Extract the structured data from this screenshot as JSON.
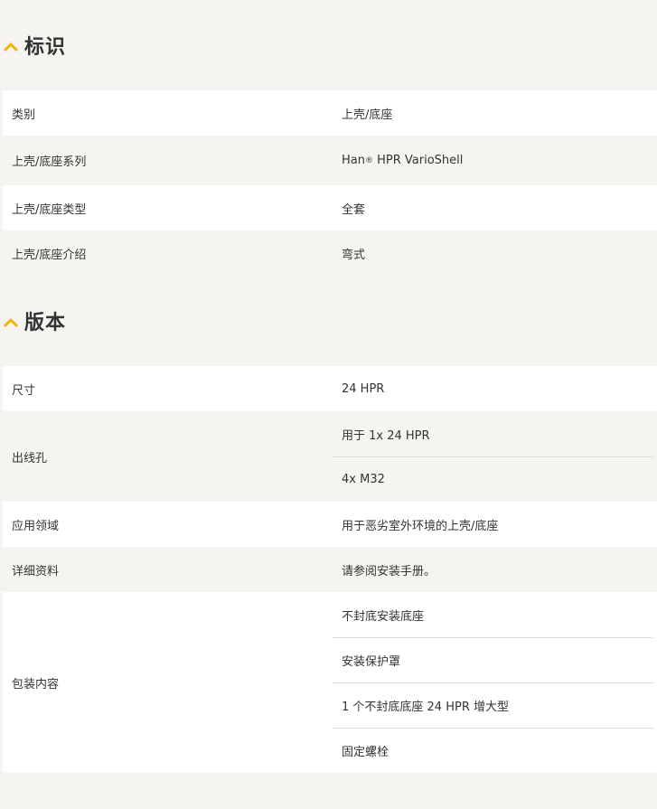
{
  "sections": [
    {
      "title": "标识",
      "rows": [
        {
          "label": "类别",
          "values": [
            "上壳/底座"
          ]
        },
        {
          "label": "上壳/底座系列",
          "values": [
            "HPR VarioShell"
          ],
          "prefix": "Han",
          "sup": "®"
        },
        {
          "label": "上壳/底座类型",
          "values": [
            "全套"
          ]
        },
        {
          "label": "上壳/底座介绍",
          "values": [
            "弯式"
          ]
        }
      ]
    },
    {
      "title": "版本",
      "rows": [
        {
          "label": "尺寸",
          "values": [
            "24 HPR"
          ]
        },
        {
          "label": "出线孔",
          "values": [
            "用于 1x 24 HPR",
            "4x M32"
          ]
        },
        {
          "label": "应用领域",
          "values": [
            "用于恶劣室外环境的上壳/底座"
          ]
        },
        {
          "label": "详细资料",
          "values": [
            "请参阅安装手册。"
          ]
        },
        {
          "label": "包装内容",
          "values": [
            "不封底安装底座",
            "安装保护罩",
            "1 个不封底底座 24 HPR 增大型",
            "固定螺栓"
          ]
        }
      ]
    }
  ],
  "colors": {
    "accent": "#f2b600",
    "row_white": "#ffffff",
    "row_gray": "#f5f4f1"
  },
  "icons": {
    "section_toggle": "chevron-up-icon"
  }
}
